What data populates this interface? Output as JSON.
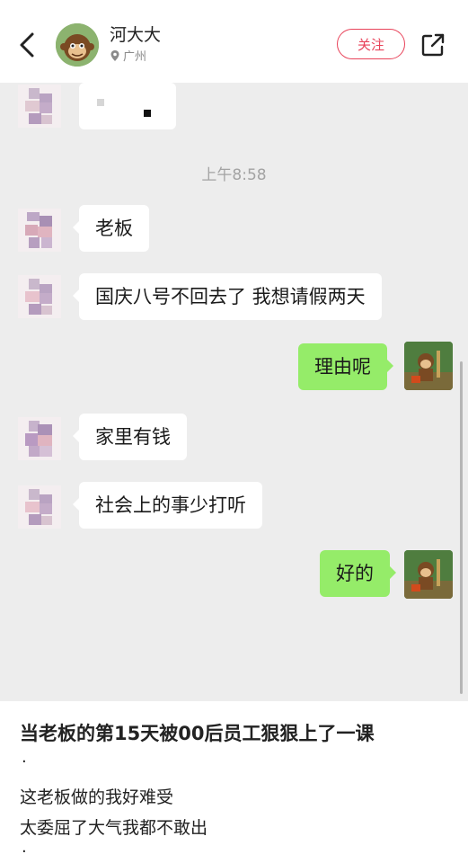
{
  "header": {
    "author_name": "河大大",
    "location": "广州",
    "follow_label": "关注"
  },
  "chat": {
    "timestamp": "上午8:58",
    "messages": [
      {
        "side": "in",
        "text": "老板"
      },
      {
        "side": "in",
        "text": "国庆八号不回去了 我想请假两天"
      },
      {
        "side": "out",
        "text": "理由呢"
      },
      {
        "side": "in",
        "text": "家里有钱"
      },
      {
        "side": "in",
        "text": "社会上的事少打听"
      },
      {
        "side": "out",
        "text": "好的"
      }
    ]
  },
  "post": {
    "title": "当老板的第15天被00后员工狠狠上了一课",
    "dot1": ".",
    "line1": "这老板做的我好难受",
    "line2": "太委屈了大气我都不敢出",
    "dot2": "."
  },
  "colors": {
    "accent": "#e8435a",
    "bubble_out": "#95ec69",
    "bubble_in": "#ffffff",
    "chat_bg": "#ededed"
  },
  "icons": [
    "chevron-left-icon",
    "location-pin-icon",
    "share-icon"
  ]
}
